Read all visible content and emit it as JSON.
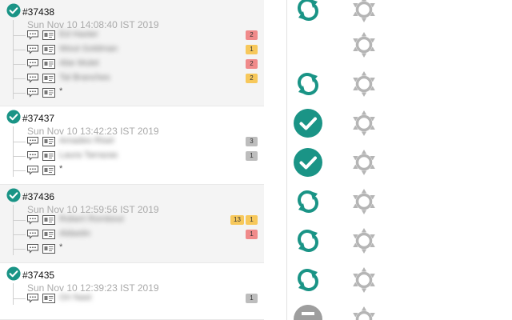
{
  "builds": [
    {
      "id": "#37438",
      "timestamp": "Sun Nov 10 14:08:40 IST 2019",
      "entries": [
        {
          "author": "Ed Haxter",
          "badges": [
            {
              "value": "2",
              "color": "red"
            }
          ]
        },
        {
          "author": "Wout Goldman",
          "badges": [
            {
              "value": "1",
              "color": "yellow"
            }
          ]
        },
        {
          "author": "Abe Mulet",
          "badges": [
            {
              "value": "2",
              "color": "red"
            }
          ]
        },
        {
          "author": "Tal Branches",
          "badges": [
            {
              "value": "2",
              "color": "yellow"
            }
          ]
        },
        {
          "author": "*",
          "badges": [],
          "plain": true
        }
      ]
    },
    {
      "id": "#37437",
      "timestamp": "Sun Nov 10 13:42:23 IST 2019",
      "entries": [
        {
          "author": "Amadeo Risel",
          "badges": [
            {
              "value": "3",
              "color": "gray"
            }
          ]
        },
        {
          "author": "Laura Tarrazas",
          "badges": [
            {
              "value": "1",
              "color": "gray"
            }
          ]
        },
        {
          "author": "*",
          "badges": [],
          "plain": true
        }
      ]
    },
    {
      "id": "#37436",
      "timestamp": "Sun Nov 10 12:59:56 IST 2019",
      "entries": [
        {
          "author": "Robert Rombout",
          "badges": [
            {
              "value": "13",
              "color": "yellow"
            },
            {
              "value": "1",
              "color": "yellow"
            }
          ]
        },
        {
          "author": "Aldastin",
          "badges": [
            {
              "value": "1",
              "color": "red"
            }
          ]
        },
        {
          "author": "*",
          "badges": [],
          "plain": true
        }
      ]
    },
    {
      "id": "#37435",
      "timestamp": "Sun Nov 10 12:39:23 IST 2019",
      "entries": [
        {
          "author": "Ori Nast",
          "badges": [
            {
              "value": "1",
              "color": "gray"
            }
          ]
        }
      ]
    }
  ],
  "status_column": [
    {
      "icon": "refresh-icon"
    },
    {
      "icon": "none"
    },
    {
      "icon": "refresh-icon"
    },
    {
      "icon": "check-circle-icon"
    },
    {
      "icon": "check-circle-icon"
    },
    {
      "icon": "refresh-icon"
    },
    {
      "icon": "refresh-icon"
    },
    {
      "icon": "refresh-icon"
    },
    {
      "icon": "gray-circle-icon"
    }
  ],
  "settings_column": [
    {
      "icon": "gear-icon"
    },
    {
      "icon": "gear-icon"
    },
    {
      "icon": "gear-icon"
    },
    {
      "icon": "gear-icon"
    },
    {
      "icon": "gear-icon"
    },
    {
      "icon": "gear-icon"
    },
    {
      "icon": "gear-icon"
    },
    {
      "icon": "gear-icon"
    },
    {
      "icon": "gear-icon"
    }
  ],
  "colors": {
    "accent": "#1a9486",
    "badge_red": "#f08a8a",
    "badge_yellow": "#f7c85b",
    "badge_gray": "#bdbdbd",
    "gear": "#b5b5b5",
    "muted_text": "#aaaaaa"
  }
}
